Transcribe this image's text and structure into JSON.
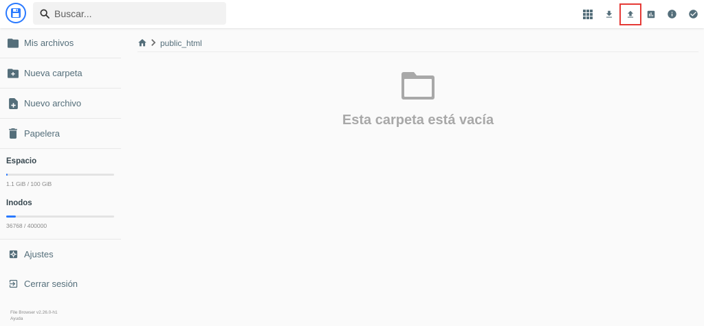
{
  "header": {
    "search_placeholder": "Buscar...",
    "actions": [
      {
        "name": "grid-view-icon"
      },
      {
        "name": "download-icon"
      },
      {
        "name": "upload-icon",
        "highlighted": true
      },
      {
        "name": "chart-icon"
      },
      {
        "name": "info-icon"
      },
      {
        "name": "check-circle-icon"
      }
    ],
    "highlight_color": "#e53935"
  },
  "sidebar": {
    "items": [
      {
        "label": "Mis archivos",
        "icon": "folder-icon"
      },
      {
        "label": "Nueva carpeta",
        "icon": "create-new-folder-icon"
      },
      {
        "label": "Nuevo archivo",
        "icon": "note-add-icon"
      },
      {
        "label": "Papelera",
        "icon": "trash-icon"
      }
    ],
    "quota": {
      "space": {
        "title": "Espacio",
        "value": "1.1 GiB / 100 GiB",
        "fill": 0.011
      },
      "inodes": {
        "title": "Inodos",
        "value": "36768 / 400000",
        "fill": 0.092
      }
    },
    "bottom_items": [
      {
        "label": "Ajustes",
        "icon": "settings-icon"
      },
      {
        "label": "Cerrar sesión",
        "icon": "exit-icon"
      }
    ],
    "footer": {
      "version": "File Browser v2.26.0-h1",
      "help": "Ayuda"
    }
  },
  "breadcrumb": {
    "folder": "public_html"
  },
  "main": {
    "empty_message": "Esta carpeta está vacía"
  },
  "colors": {
    "accent": "#2979ff",
    "text": "#546e7a",
    "empty_text": "#a8a8a8"
  }
}
